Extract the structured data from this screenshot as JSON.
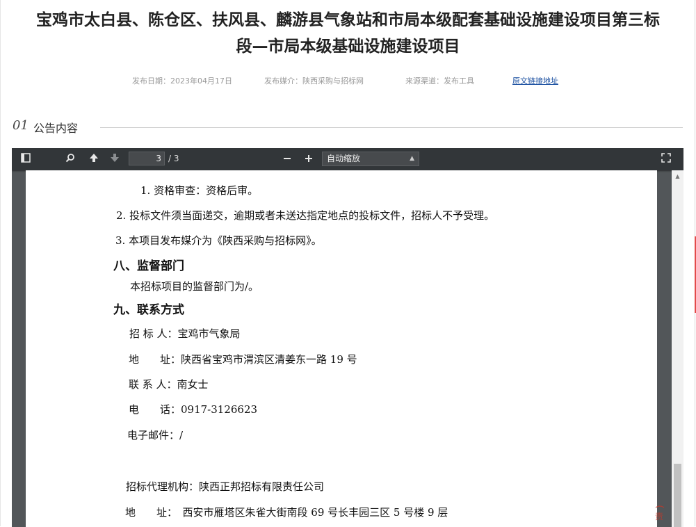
{
  "article": {
    "title_line1": "宝鸡市太白县、陈仓区、扶风县、麟游县气象站和市局本级配套基础设施建设项目第三标",
    "title_line2": "段—市局本级基础设施建设项目",
    "publish_date": "发布日期：2023年04月17日",
    "publish_media": "发布媒介：陕西采购与招标网",
    "source": "来源渠道：发布工具",
    "original_link": "原文链接地址"
  },
  "section": {
    "number": "01",
    "label": "公告内容"
  },
  "viewer": {
    "icons": {
      "sidebar": "sidebar-toggle-icon",
      "search": "search-icon",
      "prev": "arrow-up-icon",
      "next": "arrow-down-icon",
      "zoom_out": "minus-icon",
      "zoom_in": "plus-icon",
      "fullscreen": "fullscreen-icon"
    },
    "page_current": "3",
    "page_total": "/ 3",
    "zoom": "自动缩放"
  },
  "doc": {
    "l1": "1. 资格审查：资格后审。",
    "l2": "2. 投标文件须当面递交，逾期或者未送达指定地点的投标文件，招标人不予受理。",
    "l3": "3. 本项目发布媒介为《陕西采购与招标网》。",
    "h8": "八、监督部门",
    "l4": "本招标项目的监督部门为/。",
    "h9": "九、联系方式",
    "l5": "招 标 人：宝鸡市气象局",
    "l6": "地　　址：陕西省宝鸡市渭滨区清姜东一路 19 号",
    "l7": "联 系 人：南女士",
    "l8": "电　　话：0917-3126623",
    "l9": "电子邮件：/",
    "l10": "招标代理机构：陕西正邦招标有限责任公司",
    "l11": "地　　址：　西安市雁塔区朱雀大街南段 69 号长丰园三区 5 号楼 9 层",
    "stamp": "责"
  }
}
